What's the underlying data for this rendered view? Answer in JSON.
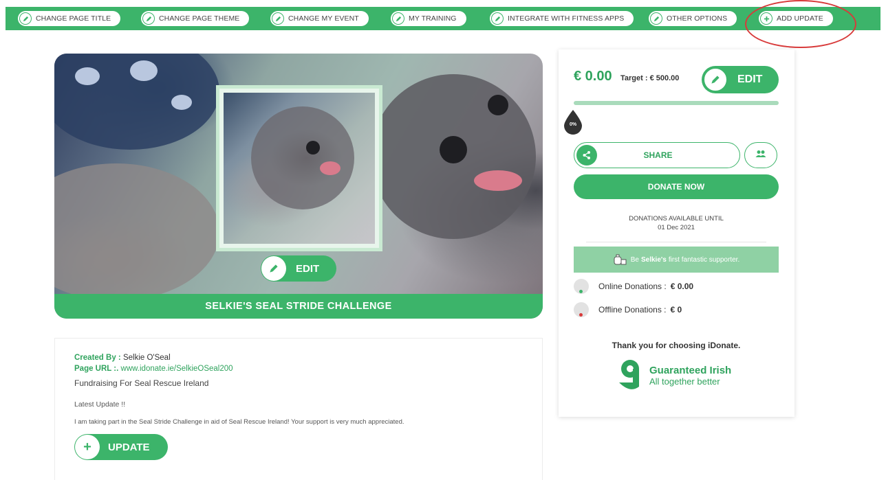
{
  "toolbar": {
    "items": [
      {
        "label": "CHANGE PAGE TITLE",
        "icon": "pencil-icon"
      },
      {
        "label": "CHANGE PAGE THEME",
        "icon": "pencil-icon"
      },
      {
        "label": "CHANGE MY EVENT",
        "icon": "pencil-icon"
      },
      {
        "label": "MY TRAINING",
        "icon": "pencil-icon"
      },
      {
        "label": "INTEGRATE WITH FITNESS APPS",
        "icon": "pencil-icon"
      },
      {
        "label": "OTHER OPTIONS",
        "icon": "pencil-icon"
      },
      {
        "label": "ADD UPDATE",
        "icon": "plus-icon"
      }
    ],
    "highlight_color": "#d83a3a"
  },
  "hero": {
    "title": "SELKIE'S SEAL STRIDE CHALLENGE",
    "edit_label": "EDIT"
  },
  "info": {
    "created_by_label": "Created By :",
    "created_by": "Selkie O'Seal",
    "page_url_label": "Page URL :.",
    "page_url": "www.idonate.ie/SelkieOSeal200",
    "fundraising": "Fundraising For Seal Rescue Ireland",
    "latest_update": "Latest Update !!",
    "description": "I am taking part in the Seal Stride Challenge in aid of Seal Rescue Ireland! Your support is very much appreciated.",
    "update_label": "UPDATE"
  },
  "sidebar": {
    "amount": "€ 0.00",
    "target": "Target : € 500.00",
    "edit_label": "EDIT",
    "progress_percent": 0,
    "progress_label": "0%",
    "share_label": "SHARE",
    "donate_label": "DONATE NOW",
    "available_label": "DONATIONS AVAILABLE UNTIL",
    "available_date": "01 Dec 2021",
    "supporter_pre": "Be",
    "supporter_name": "Selkie's",
    "supporter_post": "first fantastic supporter.",
    "online_label": "Online Donations :",
    "online_value": "€ 0.00",
    "offline_label": "Offline Donations :",
    "offline_value": "€ 0",
    "thanks": "Thank you for choosing iDonate.",
    "gi_line1": "Guaranteed Irish",
    "gi_line2": "All together better"
  },
  "colors": {
    "brand_green": "#3cb46a",
    "light_green": "#8fd1a4",
    "online_dot": "#3cb46a",
    "offline_dot": "#d83a3a"
  }
}
